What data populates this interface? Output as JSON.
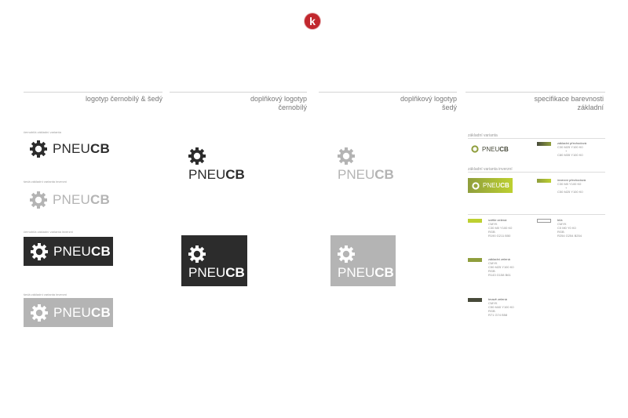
{
  "brand": {
    "letter": "k"
  },
  "columns": [
    {
      "title": "logotyp černobílý & šedý"
    },
    {
      "title_lines": [
        "doplňkový logotyp",
        "černobílý"
      ]
    },
    {
      "title_lines": [
        "doplňkový logotyp",
        "šedý"
      ]
    },
    {
      "title_lines": [
        "specifikace barevnosti",
        "základní"
      ]
    }
  ],
  "logo": {
    "light": "PNEU",
    "bold": "CB"
  },
  "col1": {
    "labels": [
      "černobílá základní varianta",
      "šedá základní varianta inverzní",
      "černobílá základní varianta inverzní",
      "šedá základní varianta inverzní"
    ]
  },
  "spec": {
    "label_basic": "základní varianta",
    "label_inverse": "základní varianta inverzní",
    "gradient1": {
      "name": "základní přechodová",
      "l1": "C30 M25 Y100 K0",
      "l2": "+",
      "l3": "C80 M35 Y100 K0"
    },
    "gradient2": {
      "name": "inverzní přechodová",
      "l1": "C30 M0 Y100 K0",
      "l2": "+",
      "l3": "C50 M25 Y100 K0"
    },
    "swatches": [
      {
        "name": "světle zelená",
        "l1": "CMYK",
        "l2": "C30 M0 Y100 K0",
        "l3": "RGB",
        "l4": "R190 G211 B50"
      },
      {
        "name": "bílá",
        "l1": "CMYK",
        "l2": "C0 M0 Y0 K0",
        "l3": "RGB",
        "l4": "R254 G254 B254"
      },
      {
        "name": "základní zelená",
        "l1": "CMYK",
        "l2": "C50 M25 Y100 K0",
        "l3": "RGB",
        "l4": "R143 G158 B61"
      },
      {
        "name": "tmavě zelená",
        "l1": "CMYK",
        "l2": "C50 M40 Y100 K0",
        "l3": "RGB",
        "l4": "R71 G74 B58"
      }
    ]
  },
  "colors": {
    "dark": "#2c2c2c",
    "grey": "#b4b4b4",
    "light_green": "#bdd030",
    "basic_green": "#8f9e3d",
    "dark_green": "#474a3a",
    "red": "#c1272d"
  }
}
